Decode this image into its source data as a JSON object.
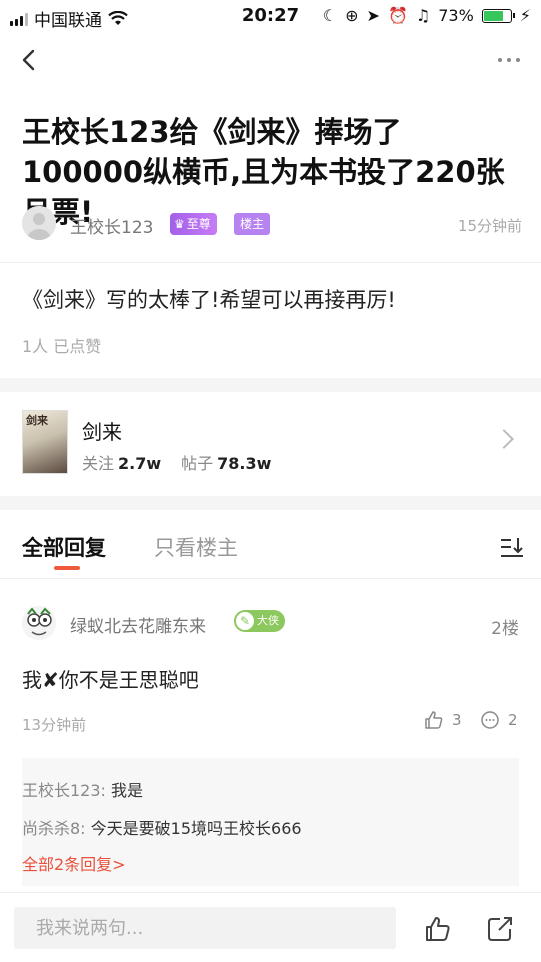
{
  "status_bar": {
    "carrier": "中国联通",
    "time": "20:27",
    "battery": "73%",
    "battery_level": 0.73
  },
  "post": {
    "title": "王校长123给《剑来》捧场了100000纵横币,且为本书投了220张月票!",
    "author": "王校长123",
    "vip_label": "至尊",
    "owner_label": "楼主",
    "time": "15分钟前",
    "body": "《剑来》写的太棒了!希望可以再接再厉!",
    "likes": "1人 已点赞"
  },
  "book": {
    "title": "剑来",
    "cover_text": "剑来",
    "follow_label": "关注",
    "follow_count": "2.7w",
    "posts_label": "帖子",
    "posts_count": "78.3w"
  },
  "tabs": {
    "all": "全部回复",
    "owner_only": "只看楼主"
  },
  "reply": {
    "name": "绿蚁北去花雕东来",
    "badge": "大侠",
    "floor": "2楼",
    "text": "我✘你不是王思聪吧",
    "time": "13分钟前",
    "like_count": "3",
    "comment_count": "2",
    "subreplies": [
      {
        "who": "王校长123:",
        "text": "我是"
      },
      {
        "who": "尚杀杀8:",
        "text": "今天是要破15境吗王校长666"
      }
    ],
    "all_replies": "全部2条回复>"
  },
  "bottom_bar": {
    "placeholder": "我来说两句..."
  },
  "colors": {
    "accent": "#f05a3c",
    "vip": "#a361e8",
    "owner": "#b683f0",
    "level": "#8dc85f"
  }
}
